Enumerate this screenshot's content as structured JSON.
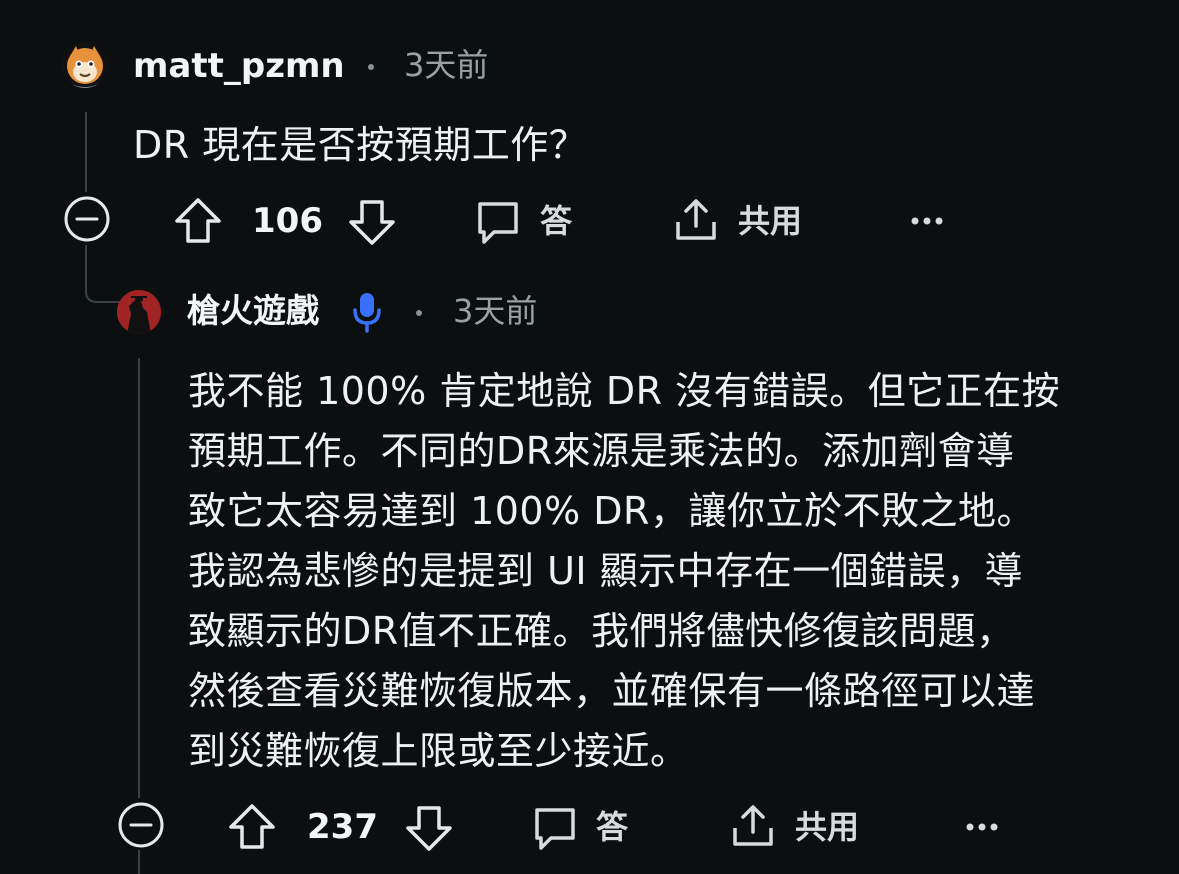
{
  "comments": [
    {
      "username": "matt_pzmn",
      "time": "3天前",
      "text": "DR 現在是否按預期工作？",
      "votes": "106",
      "reply_label": "答",
      "share_label": "共用"
    },
    {
      "username": "槍火遊戲",
      "time": "3天前",
      "text_lines": [
        "我不能 100% 肯定地說 DR 沒有錯誤。但它正在按",
        "預期工作。不同的DR來源是乘法的。添加劑會導",
        "致它太容易達到 100% DR，讓你立於不敗之地。",
        "我認為悲慘的是提到 UI 顯示中存在一個錯誤，導",
        "致顯示的DR值不正確。我們將儘快修復該問題，",
        "然後查看災難恢復版本，並確保有一條路徑可以達",
        "到災難恢復上限或至少接近。"
      ],
      "votes": "237",
      "reply_label": "答",
      "share_label": "共用"
    }
  ],
  "icons": {
    "collapse": "collapse-minus-icon",
    "upvote": "arrow-up-icon",
    "downvote": "arrow-down-icon",
    "reply": "speech-bubble-icon",
    "share": "share-icon",
    "more": "more-dots-icon",
    "mic": "microphone-icon"
  },
  "colors": {
    "background": "#0b0f10",
    "text": "#eef1f3",
    "muted": "#9aa1a5",
    "mic_accent": "#3a6ff7"
  }
}
